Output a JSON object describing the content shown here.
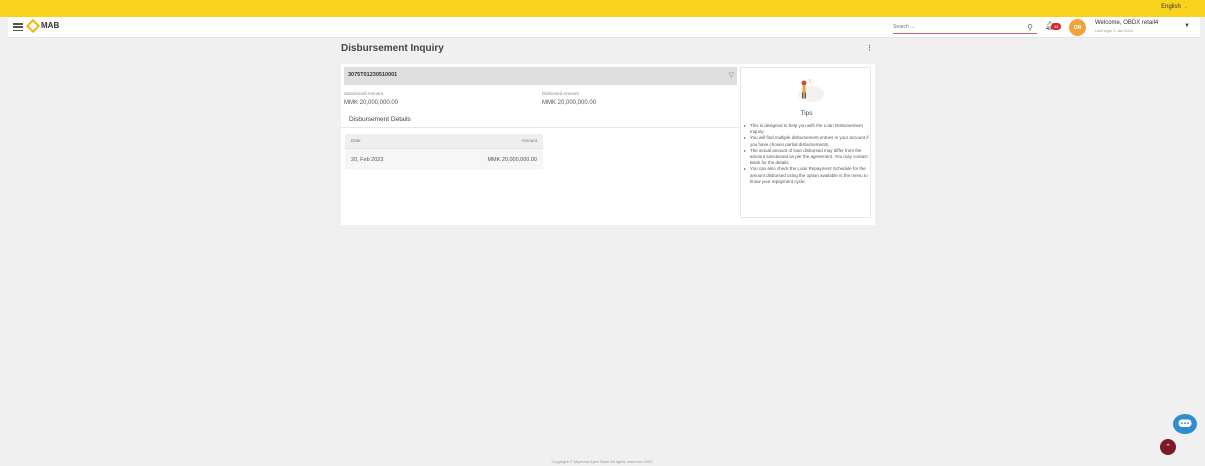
{
  "topbar": {
    "language": "English",
    "language_caret": "⌄"
  },
  "header": {
    "logo_text": "MAB",
    "search_placeholder": "Search ...",
    "notification_count": "12",
    "avatar_initials": "OR",
    "welcome": "Welcome, OBDX retail4",
    "last_login": "Last login 1 Jan 2024"
  },
  "page": {
    "title": "Disbursement Inquiry",
    "account_number": "3075T01230510001",
    "sanctioned_label": "Sanctioned Amount",
    "sanctioned_value": "MMK 20,000,000.00",
    "disbursed_label": "Disbursed Amount",
    "disbursed_value": "MMK 20,000,000.00",
    "details_title": "Disbursement Details",
    "table": {
      "columns": [
        "Date",
        "Amount"
      ],
      "rows": [
        {
          "date": "20, Feb 2023",
          "amount": "MMK 20,000,000.00"
        }
      ]
    }
  },
  "tips": {
    "title": "Tips",
    "items": [
      "This is designed to help you with the Loan Disbursement Inquiry.",
      "You will find multiple disbursement entries in your account if you have chosen partial disbursements.",
      "The actual amount of loan disbursed may differ from the amount sanctioned as per the agreement. You may contact Bank for the details.",
      "You can also check the Loan Repayment Schedule for the amount disbursed using the option available in the menu to know your repayment cycle."
    ]
  },
  "footer": {
    "copyright": "Copyright © Myanma Apex Bank All rights reserved 2023."
  },
  "colors": {
    "brand_yellow": "#f8d21c",
    "accent_maroon": "#7c1a2a",
    "chat_blue": "#2e8ecb",
    "avatar_orange": "#f0a338"
  },
  "icons": {
    "menu": "hamburger-icon",
    "search": "search-icon",
    "bell": "bell-icon",
    "dropdown": "chevron-down-icon",
    "kebab": "kebab-menu-icon",
    "chat": "chat-icon",
    "scroll_top": "chevron-up-icon"
  }
}
